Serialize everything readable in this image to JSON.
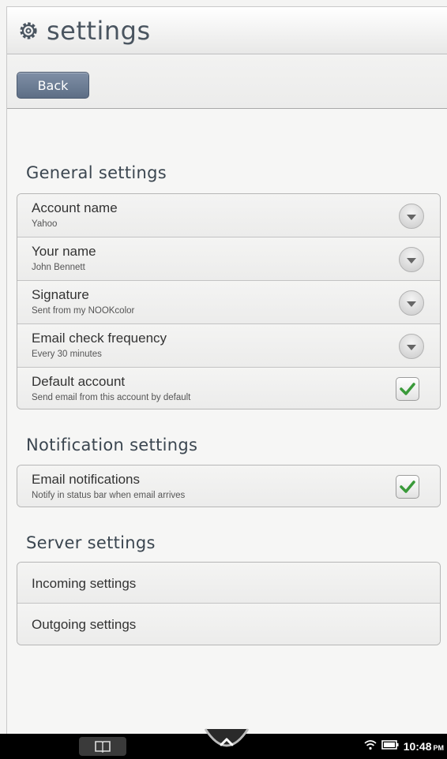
{
  "title_bar": {
    "icon": "gear-icon",
    "title": "settings"
  },
  "nav": {
    "back_label": "Back"
  },
  "general": {
    "title": "General settings",
    "items": [
      {
        "label": "Account name",
        "value": "Yahoo",
        "control": "dropdown"
      },
      {
        "label": "Your name",
        "value": "John Bennett",
        "control": "dropdown"
      },
      {
        "label": "Signature",
        "value": "Sent from my NOOKcolor",
        "control": "dropdown"
      },
      {
        "label": "Email check frequency",
        "value": "Every 30 minutes",
        "control": "dropdown"
      },
      {
        "label": "Default account",
        "value": "Send email from this account by default",
        "control": "checkbox",
        "checked": true
      }
    ]
  },
  "notification": {
    "title": "Notification settings",
    "items": [
      {
        "label": "Email notifications",
        "value": "Notify in status bar when email arrives",
        "control": "checkbox",
        "checked": true
      }
    ]
  },
  "server": {
    "title": "Server settings",
    "items": [
      {
        "label": "Incoming settings"
      },
      {
        "label": "Outgoing settings"
      }
    ]
  },
  "status_bar": {
    "time": "10:48",
    "ampm": "PM",
    "icons": [
      "library-icon",
      "home-icon",
      "wifi-icon",
      "battery-icon"
    ]
  },
  "colors": {
    "check": "#3a9a3a",
    "back_button": "#6a7b92",
    "title_text": "#4a5560"
  }
}
